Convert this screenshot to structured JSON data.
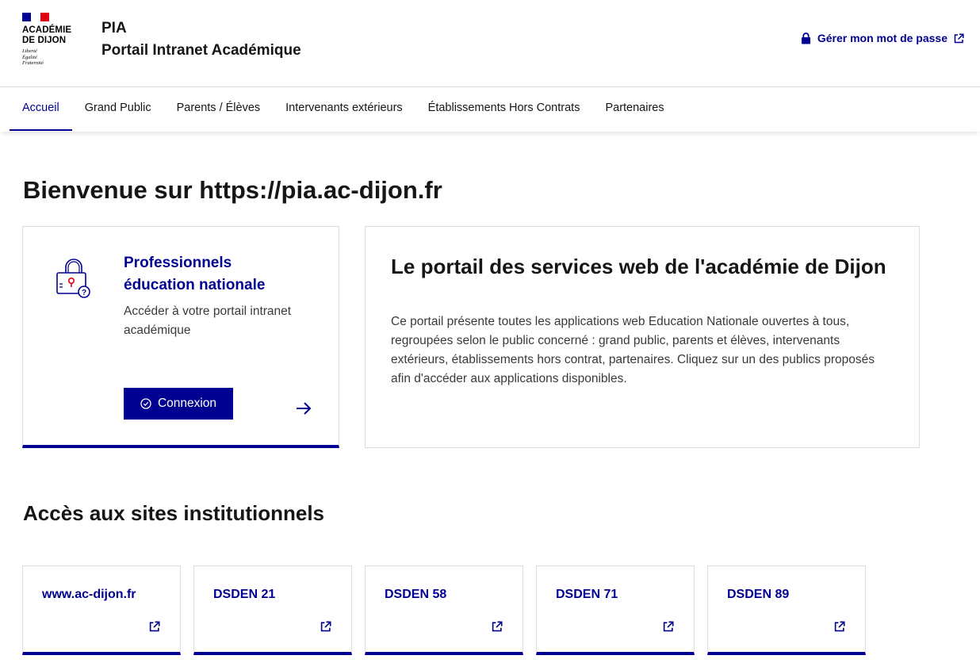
{
  "header": {
    "logo_lines": [
      "ACADÉMIE",
      "DE DIJON"
    ],
    "motto_lines": [
      "Liberté",
      "Égalité",
      "Fraternité"
    ],
    "site_name": "PIA",
    "site_subtitle": "Portail Intranet Académique",
    "password_link": "Gérer mon mot de passe"
  },
  "nav": {
    "items": [
      {
        "label": "Accueil",
        "active": true
      },
      {
        "label": "Grand Public"
      },
      {
        "label": "Parents / Élèves"
      },
      {
        "label": "Intervenants extérieurs"
      },
      {
        "label": "Établissements Hors Contrats"
      },
      {
        "label": "Partenaires"
      }
    ]
  },
  "main": {
    "title": "Bienvenue sur https://pia.ac-dijon.fr",
    "pro_card": {
      "title": "Professionnels éducation nationale",
      "description": "Accéder à votre portail intranet académique",
      "button": "Connexion"
    },
    "info_card": {
      "title": "Le portail des services web de l'académie de Dijon",
      "text": "Ce portail présente toutes les applications web Education Nationale ouvertes à tous, regroupées selon le public concerné : grand public, parents et élèves, intervenants extérieurs, établissements hors contrat, partenaires. Cliquez sur un des publics proposés afin d'accéder aux applications disponibles."
    },
    "institutional": {
      "title": "Accès aux sites institutionnels",
      "tiles": [
        {
          "label": "www.ac-dijon.fr"
        },
        {
          "label": "DSDEN 21"
        },
        {
          "label": "DSDEN 58"
        },
        {
          "label": "DSDEN 71"
        },
        {
          "label": "DSDEN 89"
        }
      ]
    }
  },
  "colors": {
    "accent": "#000091",
    "flag_red": "#e1000f",
    "text": "#161616",
    "border": "#dddddd"
  },
  "icons": [
    "lock-icon",
    "external-link-icon",
    "padlock-help-icon",
    "check-circle-icon",
    "arrow-right-icon"
  ]
}
